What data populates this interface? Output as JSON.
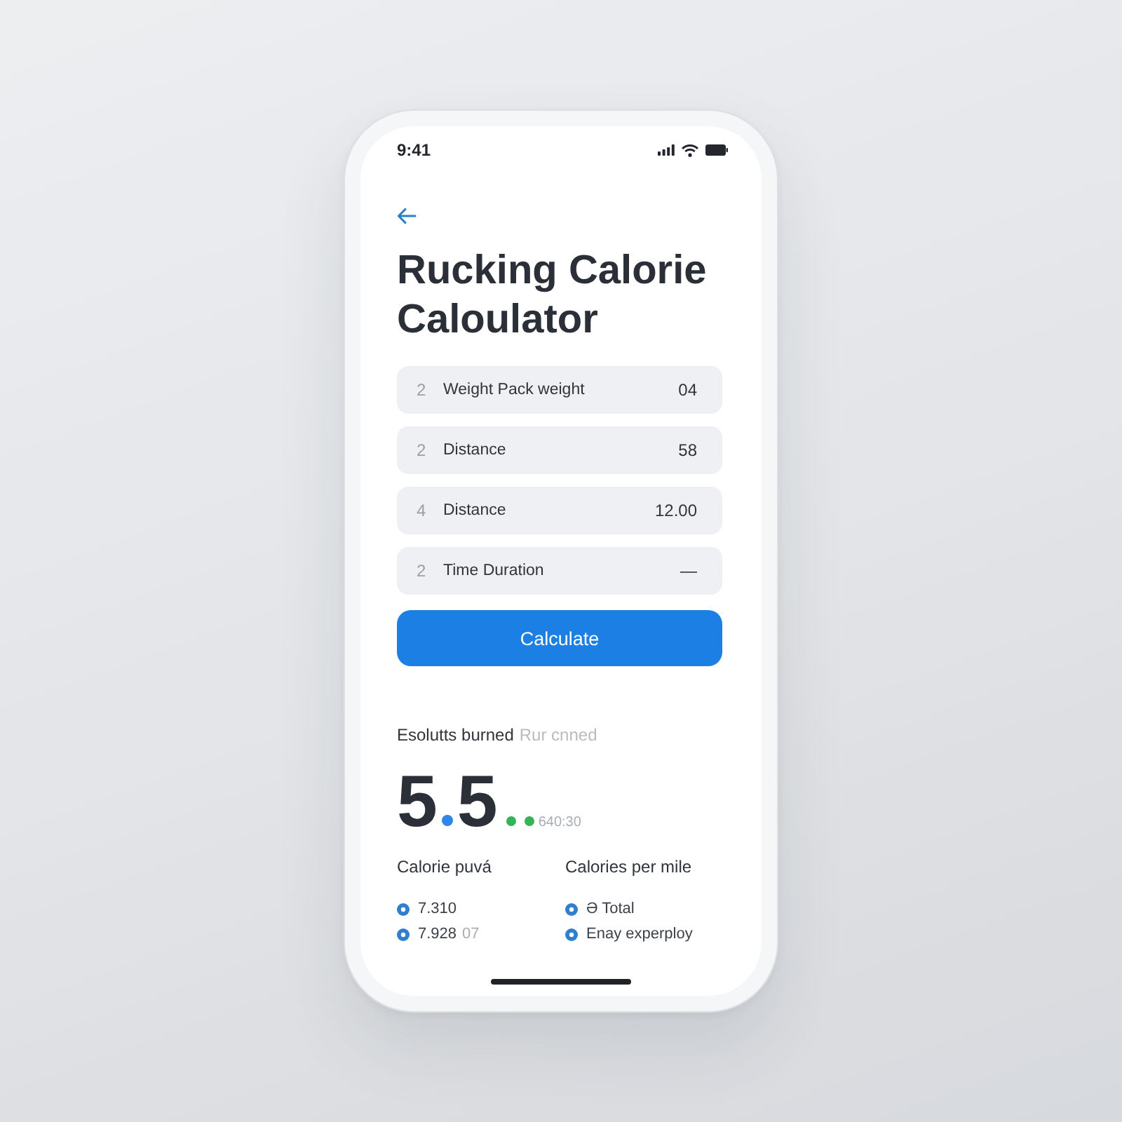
{
  "status_bar": {
    "time": "9:41"
  },
  "header": {
    "title": "Rucking Calorie Caloulator"
  },
  "fields": [
    {
      "index": "2",
      "label": "Weight Pack weight",
      "value": "04"
    },
    {
      "index": "2",
      "label": "Distance",
      "value": "58"
    },
    {
      "index": "4",
      "label": "Distance",
      "value": "12.00"
    },
    {
      "index": "2",
      "label": "Time Duration",
      "value": "—"
    }
  ],
  "calculate_button": {
    "label": "Calculate"
  },
  "result": {
    "label": "Esolutts burned",
    "hint": "Rur cnned",
    "whole": "5",
    "fraction": "5",
    "suffix": "640:30"
  },
  "stats": [
    {
      "heading": "Calorie puvá",
      "items": [
        {
          "text": "7.310"
        },
        {
          "text": "7.928",
          "note": "07"
        }
      ]
    },
    {
      "heading": "Calories per mile",
      "items": [
        {
          "text": "Ə Total"
        },
        {
          "text": "Enay experploy"
        }
      ]
    }
  ]
}
